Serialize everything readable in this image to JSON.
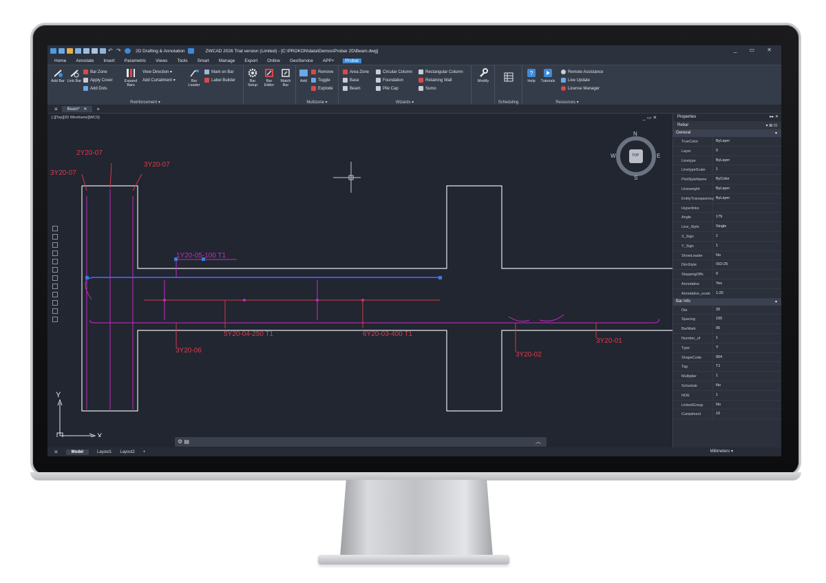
{
  "titlebar": {
    "workspace": "2D Drafting & Annotation",
    "title": "ZWCAD 2026 Trial version (Limited) - [C:\\PROKON\\data\\Demos\\Probar 2D\\Beam.dwg]"
  },
  "menu": [
    "Home",
    "Annotate",
    "Insert",
    "Parametric",
    "Views",
    "Tools",
    "Smart",
    "Manage",
    "Export",
    "Online",
    "GeoService",
    "APP+",
    "Probar"
  ],
  "ribbon": {
    "add_bar": "Add Bar",
    "link_bar": "Link Bar",
    "bar_zone": "Bar Zone",
    "apply_cover": "Apply Cover",
    "add_dots": "Add Dots",
    "expand_bars": "Expand Bars",
    "view_direction": "View Direction",
    "add_curtailment": "Add Curtailment",
    "bar_leader": "Bar Leader",
    "mark_on_bar": "Mark on Bar",
    "label_builder": "Label Builder",
    "bar_setup": "Bar Setup",
    "bar_editor": "Bar Editor",
    "match_bar": "Match Bar",
    "add": "Add",
    "remove": "Remove",
    "toggle": "Toggle",
    "explode": "Explode",
    "area_zone": "Area Zone",
    "base": "Base",
    "beam": "Beam",
    "circular_column": "Circular Column",
    "foundation": "Foundation",
    "pile_cap": "Pile Cap",
    "rectangular_column": "Rectangular Column",
    "retaining_wall": "Retaining Wall",
    "sumo": "Sumo",
    "modify": "Modify",
    "help": "Help",
    "tutorials": "Tutorials",
    "remote_assistance": "Remote Assistance",
    "live_update": "Live Update",
    "license_manager": "License Manager",
    "groups": {
      "reinforcement": "Reinforcement",
      "multizone": "Multizone",
      "wizards": "Wizards",
      "scheduling": "Scheduling",
      "resources": "Resources"
    }
  },
  "doc_tab": "Beam*",
  "view_label": "[-][Top][2D Wireframe][WCS]",
  "viewcube": {
    "n": "N",
    "s": "S",
    "e": "E",
    "w": "W",
    "face": "TOP"
  },
  "drawing_labels": {
    "l1": "3Y20-07",
    "l2": "2Y20-07",
    "l3": "3Y20-07",
    "l4": "1Y20-05-100 T1",
    "l5": "5Y20-04-250 T1",
    "l6": "6Y20-03-400 T1",
    "l7": "3Y20-06",
    "l8": "3Y20-02",
    "l9": "3Y20-01",
    "axis_x": "X",
    "axis_y": "Y"
  },
  "properties": {
    "title": "Properties",
    "selected": "Rebar",
    "general_label": "General",
    "general": [
      {
        "k": "TrueColor",
        "v": "ByLayer"
      },
      {
        "k": "Layer",
        "v": "0"
      },
      {
        "k": "Linetype",
        "v": "ByLayer"
      },
      {
        "k": "LinetypeScale",
        "v": "1"
      },
      {
        "k": "PlotStyleName",
        "v": "ByColor"
      },
      {
        "k": "Lineweight",
        "v": "ByLayer"
      },
      {
        "k": "EntityTransparency",
        "v": "ByLayer"
      },
      {
        "k": "Hyperlinks",
        "v": ""
      },
      {
        "k": "Angle",
        "v": "179"
      },
      {
        "k": "Line_Style",
        "v": "Single"
      },
      {
        "k": "X_Sign",
        "v": "1"
      },
      {
        "k": "Y_Sign",
        "v": "1"
      },
      {
        "k": "ShowLeader",
        "v": "No"
      },
      {
        "k": "DimStyle",
        "v": "ISO-25"
      },
      {
        "k": "SteppingOffs",
        "v": "0"
      },
      {
        "k": "Annotative",
        "v": "Yes"
      },
      {
        "k": "Annotative_scale",
        "v": "1:20"
      }
    ],
    "barinfo_label": "Bar Info",
    "barinfo": [
      {
        "k": "Dia",
        "v": "20"
      },
      {
        "k": "Spacing",
        "v": "100"
      },
      {
        "k": "BarMark",
        "v": "05"
      },
      {
        "k": "Number_of",
        "v": "1"
      },
      {
        "k": "Type",
        "v": "Y"
      },
      {
        "k": "ShapeCode",
        "v": "004"
      },
      {
        "k": "Tag",
        "v": "T1"
      },
      {
        "k": "Multiplier",
        "v": "1"
      },
      {
        "k": "Schedule",
        "v": "No"
      },
      {
        "k": "NOE",
        "v": "1"
      },
      {
        "k": "LinkedGroup",
        "v": "No"
      },
      {
        "k": "Curtailment",
        "v": "10"
      }
    ]
  },
  "layouts": [
    "Model",
    "Layout1",
    "Layout2"
  ],
  "units": "Millimeters"
}
